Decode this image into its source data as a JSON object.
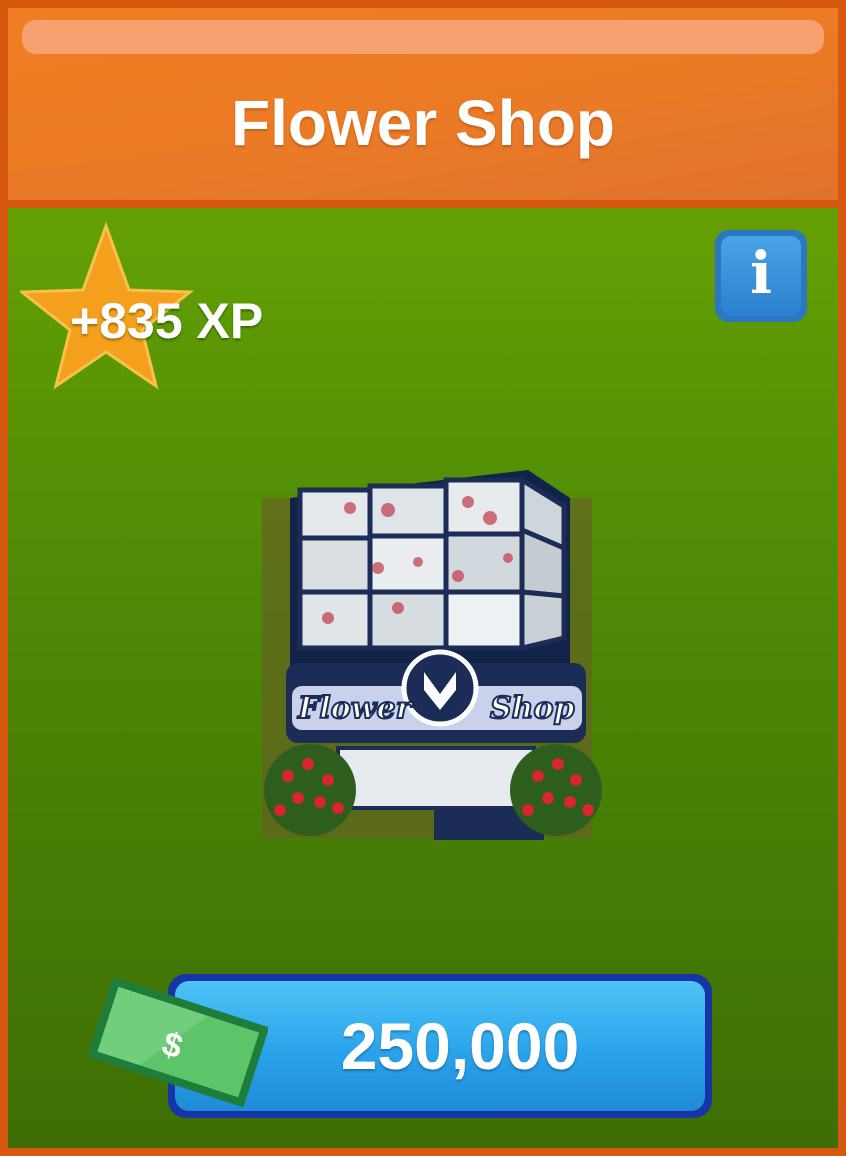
{
  "header": {
    "title": "Flower Shop"
  },
  "reward": {
    "xp_label": "+835 XP"
  },
  "info_button": {
    "glyph": "i",
    "icon": "info-icon"
  },
  "item": {
    "image_icon": "flower-shop-building",
    "sign_text_left": "Flower",
    "sign_text_right": "Shop"
  },
  "purchase": {
    "price": "250,000",
    "currency_icon": "dollar-bill-icon",
    "currency_symbol": "$"
  },
  "colors": {
    "header": "#f07e22",
    "panel": "#4e8a06",
    "frame": "#d7590f",
    "button": "#2aa3ea",
    "star": "#f5a01c"
  }
}
